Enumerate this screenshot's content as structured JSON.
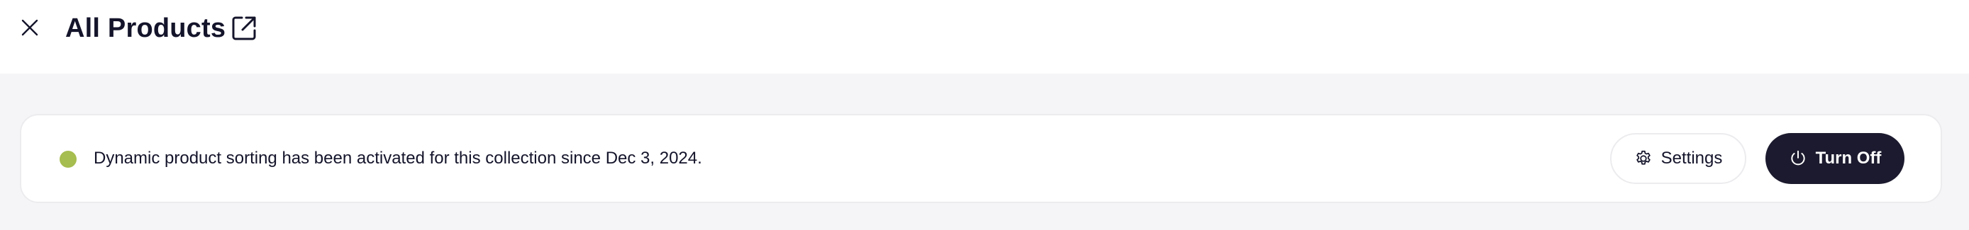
{
  "header": {
    "title": "All Products",
    "close_icon": "close-icon",
    "external_icon": "external-link-icon"
  },
  "banner": {
    "status_color": "#a6bd4f",
    "message": "Dynamic product sorting has been activated for this collection since Dec 3, 2024.",
    "settings_label": "Settings",
    "settings_icon": "gear-icon",
    "turn_off_label": "Turn Off",
    "turn_off_icon": "power-icon",
    "turn_off_bg": "#1b1a2e"
  }
}
